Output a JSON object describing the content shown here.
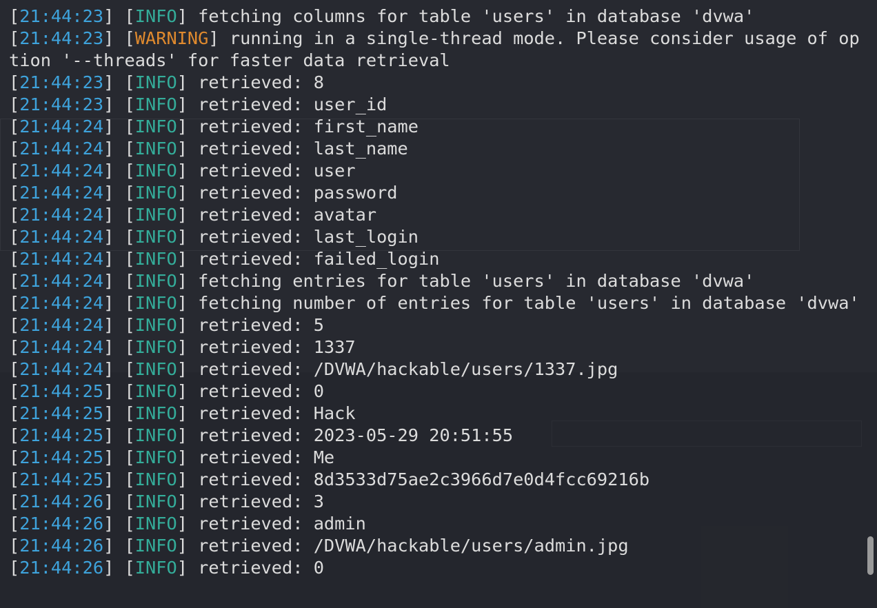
{
  "log": {
    "lines": [
      {
        "time": "21:44:23",
        "level": "INFO",
        "msg": "fetching columns for table 'users' in database 'dvwa'"
      },
      {
        "time": "21:44:23",
        "level": "WARNING",
        "msg": "running in a single-thread mode. Please consider usage of option '--threads' for faster data retrieval"
      },
      {
        "time": "21:44:23",
        "level": "INFO",
        "msg": "retrieved: 8"
      },
      {
        "time": "21:44:23",
        "level": "INFO",
        "msg": "retrieved: user_id"
      },
      {
        "time": "21:44:24",
        "level": "INFO",
        "msg": "retrieved: first_name"
      },
      {
        "time": "21:44:24",
        "level": "INFO",
        "msg": "retrieved: last_name"
      },
      {
        "time": "21:44:24",
        "level": "INFO",
        "msg": "retrieved: user"
      },
      {
        "time": "21:44:24",
        "level": "INFO",
        "msg": "retrieved: password"
      },
      {
        "time": "21:44:24",
        "level": "INFO",
        "msg": "retrieved: avatar"
      },
      {
        "time": "21:44:24",
        "level": "INFO",
        "msg": "retrieved: last_login"
      },
      {
        "time": "21:44:24",
        "level": "INFO",
        "msg": "retrieved: failed_login"
      },
      {
        "time": "21:44:24",
        "level": "INFO",
        "msg": "fetching entries for table 'users' in database 'dvwa'"
      },
      {
        "time": "21:44:24",
        "level": "INFO",
        "msg": "fetching number of entries for table 'users' in database 'dvwa'"
      },
      {
        "time": "21:44:24",
        "level": "INFO",
        "msg": "retrieved: 5"
      },
      {
        "time": "21:44:24",
        "level": "INFO",
        "msg": "retrieved: 1337"
      },
      {
        "time": "21:44:24",
        "level": "INFO",
        "msg": "retrieved: /DVWA/hackable/users/1337.jpg"
      },
      {
        "time": "21:44:25",
        "level": "INFO",
        "msg": "retrieved: 0"
      },
      {
        "time": "21:44:25",
        "level": "INFO",
        "msg": "retrieved: Hack"
      },
      {
        "time": "21:44:25",
        "level": "INFO",
        "msg": "retrieved: 2023-05-29 20:51:55"
      },
      {
        "time": "21:44:25",
        "level": "INFO",
        "msg": "retrieved: Me"
      },
      {
        "time": "21:44:25",
        "level": "INFO",
        "msg": "retrieved: 8d3533d75ae2c3966d7e0d4fcc69216b"
      },
      {
        "time": "21:44:26",
        "level": "INFO",
        "msg": "retrieved: 3"
      },
      {
        "time": "21:44:26",
        "level": "INFO",
        "msg": "retrieved: admin"
      },
      {
        "time": "21:44:26",
        "level": "INFO",
        "msg": "retrieved: /DVWA/hackable/users/admin.jpg"
      },
      {
        "time": "21:44:26",
        "level": "INFO",
        "msg": "retrieved: 0"
      }
    ]
  },
  "colors": {
    "background": "#272930",
    "text": "#dcdcdc",
    "timestamp": "#3ea3dc",
    "info": "#34ad9a",
    "warning": "#e08a2e"
  }
}
